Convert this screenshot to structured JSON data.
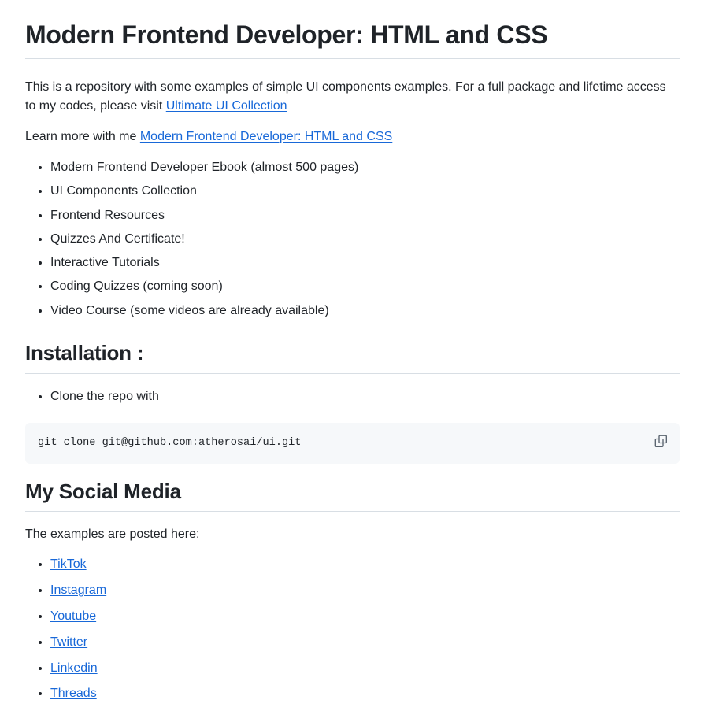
{
  "document": {
    "title": "Modern Frontend Developer: HTML and CSS",
    "intro": {
      "text_before": "This is a repository with some examples of simple UI components examples. For a full package and lifetime access to my codes, please visit ",
      "link_label": "Ultimate UI Collection",
      "text_after": ""
    },
    "learn_more": {
      "text_before": "Learn more with me ",
      "link_label": "Modern Frontend Developer: HTML and CSS"
    },
    "features": [
      "Modern Frontend Developer Ebook (almost 500 pages)",
      "UI Components Collection",
      "Frontend Resources",
      "Quizzes And Certificate!",
      "Interactive Tutorials",
      "Coding Quizzes (coming soon)",
      "Video Course (some videos are already available)"
    ],
    "installation": {
      "heading": "Installation :",
      "steps": [
        "Clone the repo with"
      ],
      "code": "git clone git@github.com:atherosai/ui.git",
      "copy_icon": "copy-icon",
      "copy_label": "Copy"
    },
    "social": {
      "heading": "My Social Media",
      "intro": "The examples are posted here:",
      "links": [
        "TikTok",
        "Instagram",
        "Youtube",
        "Twitter",
        "Linkedin",
        "Threads"
      ]
    }
  },
  "colors": {
    "link": "#1868d8",
    "text": "#1f2328",
    "rule": "#d8dee4",
    "code_background": "#f6f8fa",
    "page_background": "#ffffff"
  }
}
